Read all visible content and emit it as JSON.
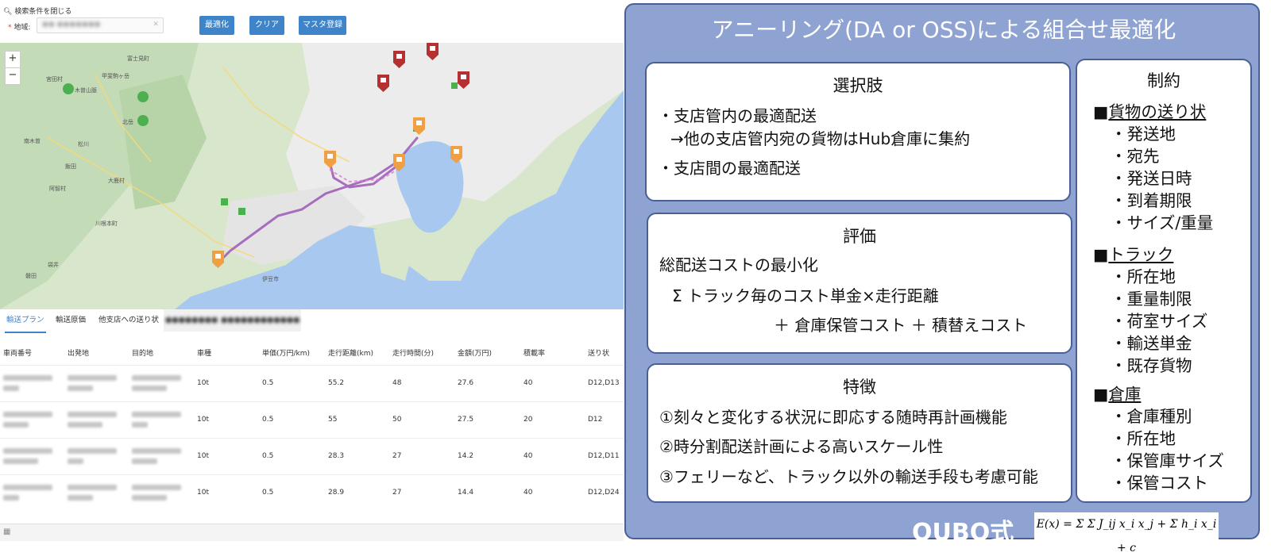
{
  "search": {
    "toggle_label": "検索条件を閉じる",
    "region_label": "地域:",
    "region_value": "●● ●●●●●●●",
    "buttons": {
      "optimize": "最適化",
      "clear": "クリア",
      "master": "マスタ登録"
    }
  },
  "map": {
    "zoom_in": "+",
    "zoom_out": "−",
    "place_labels": [
      "木曽山脈",
      "甲斐駒ヶ岳",
      "北岳",
      "南木曽",
      "松川",
      "飯田",
      "阿智村",
      "富士見町",
      "宮田村",
      "大鹿村",
      "袋井",
      "磐田",
      "伊豆市",
      "川根本町"
    ],
    "colors": {
      "land": "#d8e6cc",
      "sea": "#a8c8ef",
      "urban": "#ececec",
      "route": "#9b59b6",
      "marker_orange": "#f0a044",
      "marker_red": "#b53030"
    }
  },
  "tabs": [
    "輸送プラン",
    "輸送原価",
    "他支店への送り状",
    "●●●●●●●●",
    "●●●●●●●●●●●●"
  ],
  "table": {
    "headers": [
      "車両番号",
      "出発地",
      "目的地",
      "車種",
      "単価(万円/km)",
      "走行距離(km)",
      "走行時間(分)",
      "金額(万円)",
      "積載率",
      "送り状"
    ],
    "rows": [
      {
        "type": "10t",
        "unit_price": "0.5",
        "distance": "55.2",
        "time": "48",
        "amount": "27.6",
        "load": "40",
        "invoice": "D12,D13"
      },
      {
        "type": "10t",
        "unit_price": "0.5",
        "distance": "55",
        "time": "50",
        "amount": "27.5",
        "load": "20",
        "invoice": "D12"
      },
      {
        "type": "10t",
        "unit_price": "0.5",
        "distance": "28.3",
        "time": "27",
        "amount": "14.2",
        "load": "40",
        "invoice": "D12,D11"
      },
      {
        "type": "10t",
        "unit_price": "0.5",
        "distance": "28.9",
        "time": "27",
        "amount": "14.4",
        "load": "40",
        "invoice": "D12,D24"
      }
    ]
  },
  "panel": {
    "title": "アニーリング(DA or OSS)による組合せ最適化",
    "choices": {
      "title": "選択肢",
      "line1": "・支店管内の最適配送",
      "line2": "→他の支店管内宛の貨物はHub倉庫に集約",
      "line3": "・支店間の最適配送"
    },
    "evaluation": {
      "title": "評価",
      "line1": "総配送コストの最小化",
      "line2": "Σ トラック毎のコスト単金×走行距離",
      "line3": "＋ 倉庫保管コスト ＋ 積替えコスト"
    },
    "features": {
      "title": "特徴",
      "line1": "①刻々と変化する状況に即応する随時再計画機能",
      "line2": "②時分割配送計画による高いスケール性",
      "line3": "③フェリーなど、トラック以外の輸送手段も考慮可能"
    },
    "constraints": {
      "title": "制約",
      "groups": [
        {
          "head": "貨物の送り状",
          "items": [
            "・発送地",
            "・宛先",
            "・発送日時",
            "・到着期限",
            "・サイズ/重量"
          ]
        },
        {
          "head": "トラック",
          "items": [
            "・所在地",
            "・重量制限",
            "・荷室サイズ",
            "・輸送単金",
            "・既存貨物"
          ]
        },
        {
          "head": "倉庫",
          "items": [
            "・倉庫種別",
            "・所在地",
            "・保管庫サイズ",
            "・保管コスト"
          ]
        }
      ],
      "bullet": "■"
    },
    "qubo_label": "QUBO式",
    "formula": "E(x) = Σ Σ J_ij x_i x_j + Σ h_i x_i + c"
  },
  "colors": {
    "panel_bg": "#8ea3d2",
    "panel_border": "#4a5f96",
    "button": "#3f84c9"
  }
}
